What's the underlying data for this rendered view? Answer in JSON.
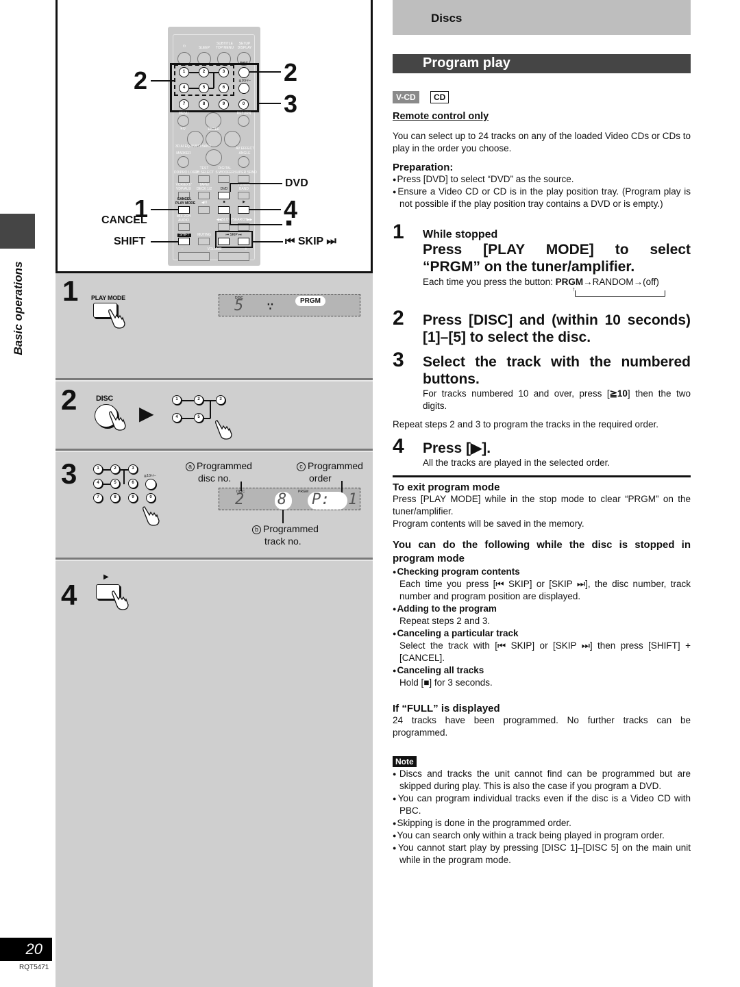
{
  "side": {
    "section_label": "Basic operations",
    "page_number": "20",
    "doc_code": "RQT5471"
  },
  "remote": {
    "labels": {
      "power": "⏻",
      "sleep": "SLEEP",
      "subtitle_top": "SUBTITLE",
      "top_menu": "TOP MENU",
      "setup": "SETUP",
      "display": "DISPLAY",
      "disc": "DISC",
      "ge10": "≧10/-/--",
      "menu": "MENU",
      "return": "RETURN",
      "eq": "EQ",
      "enter": "ENTER",
      "marker_top": "3D AI EQ MULTI BAND",
      "marker": "MARKER",
      "angle_top": "AV EFFECT",
      "angle": "ANGLE",
      "dolby": "DD/PRO LOGIC",
      "test": "TEST",
      "ch_select": "CH SELECT",
      "digital": "DIGITAL",
      "subwoofer": "S.WOOFER",
      "super_srnd": "SUPER SRND",
      "vcr": "VCR/EXT/",
      "vdp": "VDP/AUX",
      "tape": "TAPE/",
      "deck": "DECK 1/2",
      "dvd": "DVD",
      "tuner": "TUNER/",
      "band": "BAND",
      "cancel": "CANCEL",
      "play_mode": "PLAY MODE",
      "slow": "◀/II",
      "stop": "■",
      "play": "▶",
      "mix": "MIX 2CH",
      "audio": "AUDIO",
      "search": "◀◀SLOW/SEARCH▶▶",
      "shift": "SHIFT",
      "muting": "MUTING",
      "skip": "⏮ SKIP ⏭",
      "volume": "VOLUME",
      "vol_minus": "–",
      "vol_plus": "+"
    },
    "number_buttons": [
      "1",
      "2",
      "3",
      "4",
      "5",
      "6",
      "7",
      "8",
      "9",
      "0"
    ],
    "callouts": {
      "left_2": "2",
      "right_2": "2",
      "right_3": "3",
      "dvd": "DVD",
      "left_1": "1",
      "cancel": "CANCEL",
      "right_4": "4",
      "stop": "■",
      "shift": "SHIFT",
      "skip": "⏮ SKIP ⏭"
    }
  },
  "illustrations": {
    "step1": {
      "num": "1",
      "button_label": "PLAY MODE",
      "display_disc_label": "DISC",
      "display_digit": "5",
      "display_spinner": "∵",
      "prgm": "PRGM"
    },
    "step2": {
      "num": "2",
      "button_label": "DISC",
      "arrow": "▶",
      "buttons": [
        "1",
        "2",
        "3",
        "4",
        "5"
      ]
    },
    "step3": {
      "num": "3",
      "buttons": [
        "1",
        "2",
        "3",
        "4",
        "5",
        "6",
        "7",
        "8",
        "9",
        "0"
      ],
      "ge10_label": "≧10/-/--",
      "annot_a_mark": "a",
      "annot_a": [
        "Programmed",
        "disc no."
      ],
      "annot_b_mark": "b",
      "annot_b": [
        "Programmed",
        "track no."
      ],
      "annot_c_mark": "c",
      "annot_c": [
        "Programmed",
        "order"
      ],
      "display_disc_label": "DISC",
      "display_prgm_label": "PRGM",
      "display_disc": "2",
      "display_track": "8",
      "display_order": "P:  1"
    },
    "step4": {
      "num": "4",
      "button_symbol": "▶"
    }
  },
  "right": {
    "section": "Discs",
    "title": "Program play",
    "badges": [
      "V-CD",
      "CD"
    ],
    "remote_only": "Remote control only",
    "intro": "You can select up to 24 tracks on any of the loaded Video CDs or CDs to play in the order you choose.",
    "preparation": {
      "heading": "Preparation:",
      "items": [
        "Press [DVD] to select “DVD” as the source.",
        "Ensure a Video CD or CD is in the play position tray. (Program play is not possible if the play position tray contains a DVD or is empty.)"
      ]
    },
    "steps": [
      {
        "num": "1",
        "pre": "While stopped",
        "head_line1": "Press [PLAY MODE] to select",
        "head_line2": "“PRGM” on the tuner/amplifier.",
        "body_prefix": "Each time you press the button:",
        "cycle_bold": "PRGM",
        "cycle_rest": "→RANDOM→(off)"
      },
      {
        "num": "2",
        "head": "Press [DISC] and (within 10 seconds) [1]–[5] to select the disc."
      },
      {
        "num": "3",
        "head": "Select the track with the numbered buttons.",
        "body_pre": "For tracks numbered 10 and over, press [",
        "body_key": "≧10",
        "body_post": "] then the two digits."
      },
      {
        "num": "4",
        "head": "Press [▶].",
        "body": "All the tracks are played in the selected order."
      }
    ],
    "repeat_note": "Repeat steps 2 and 3 to program the tracks in the required order.",
    "exit": {
      "heading": "To exit program mode",
      "line1": "Press [PLAY MODE] while in the stop mode to clear “PRGM” on the tuner/amplifier.",
      "line2": "Program contents will be saved in the memory."
    },
    "stopped": {
      "heading": "You can do the following while the disc is stopped in program mode",
      "items": [
        {
          "title": "Checking program contents",
          "body": "Each time you press [⏮ SKIP] or [SKIP ⏭], the disc number, track number and program position are displayed."
        },
        {
          "title": "Adding to the program",
          "body": "Repeat steps 2 and 3."
        },
        {
          "title": "Canceling a particular track",
          "body": "Select the track with [⏮ SKIP] or [SKIP ⏭] then press [SHIFT] + [CANCEL]."
        },
        {
          "title": "Canceling all tracks",
          "body": "Hold [■] for 3 seconds."
        }
      ]
    },
    "full": {
      "heading": "If “FULL” is displayed",
      "body": "24 tracks have been programmed. No further tracks can be programmed."
    },
    "note": {
      "label": "Note",
      "items": [
        "Discs and tracks the unit cannot find can be programmed but are skipped during play. This is also the case if you program a DVD.",
        "You can program individual tracks even if the disc is a Video CD with PBC.",
        "Skipping is done in the programmed order.",
        "You can search only within a track being played in program order.",
        "You cannot start play by pressing [DISC 1]–[DISC 5] on the main unit while in the program mode."
      ]
    }
  }
}
